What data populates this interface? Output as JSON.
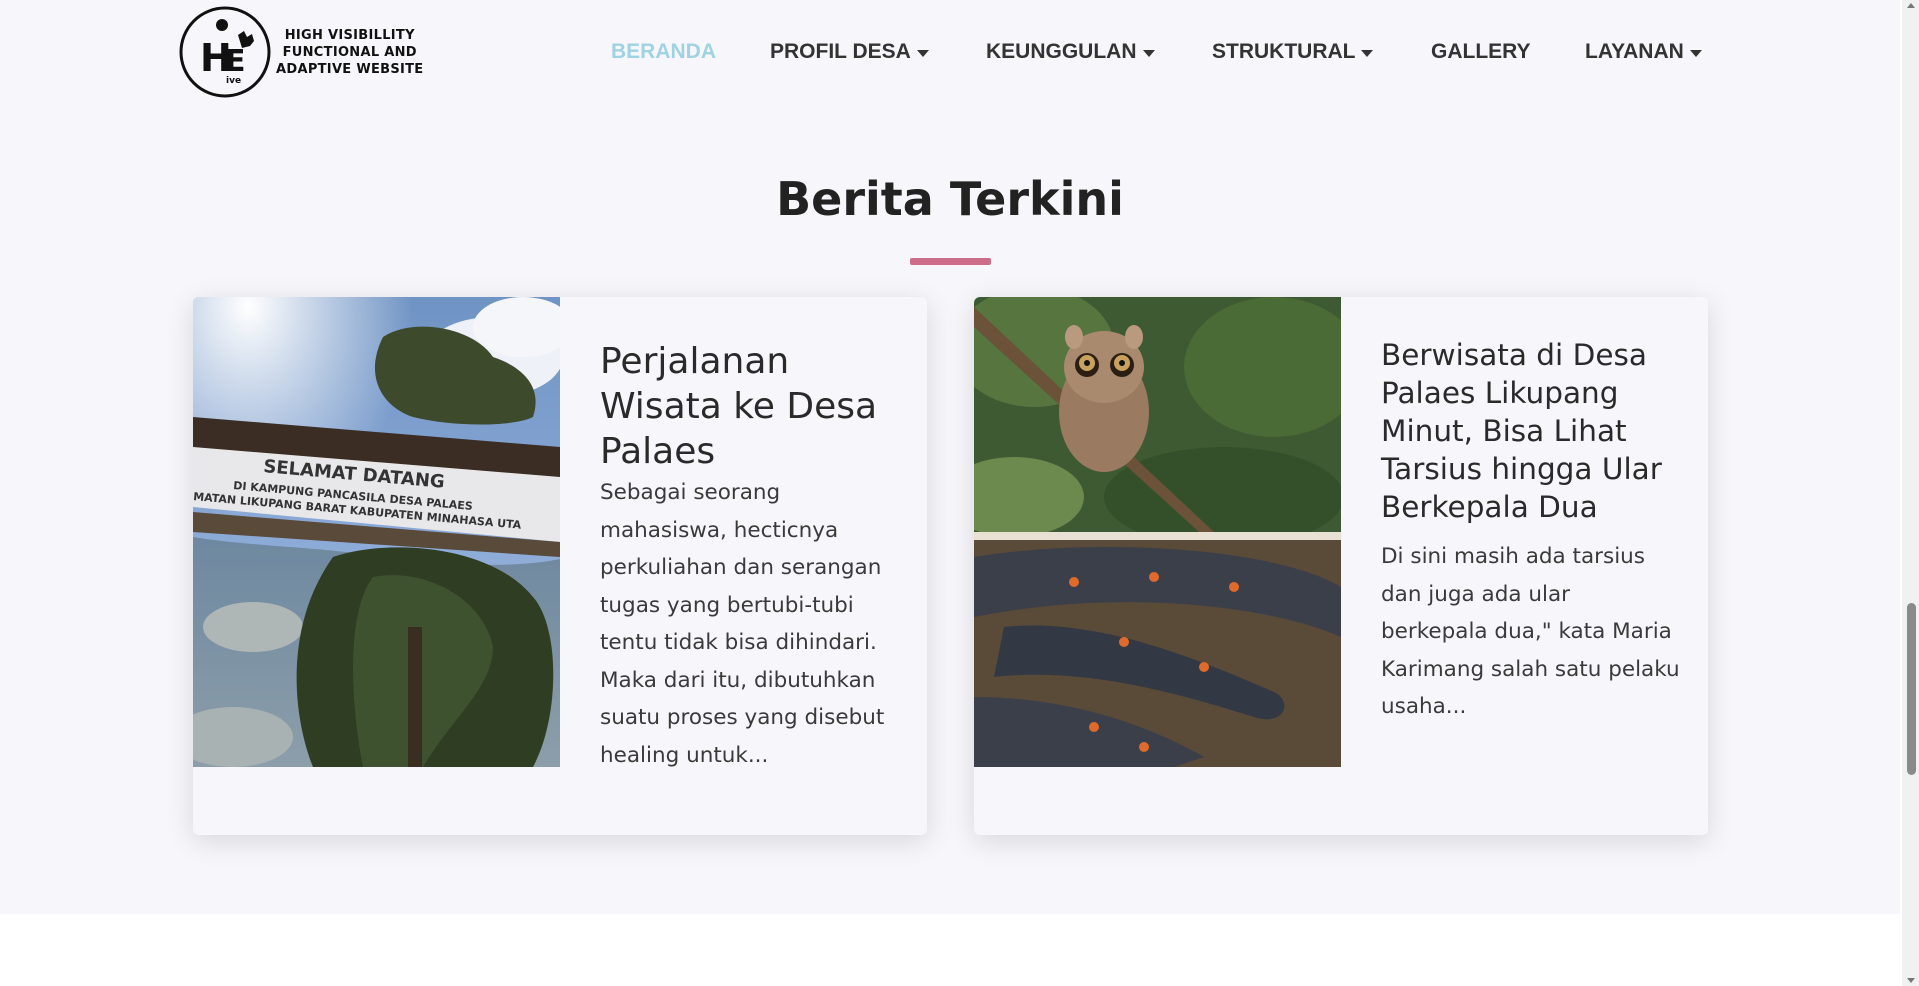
{
  "logo": {
    "line1": "HIGH VISIBILLITY",
    "line2": "FUNCTIONAL AND",
    "line3": "ADAPTIVE WEBSITE",
    "mark_letters": "HE",
    "mark_sub": "ive"
  },
  "nav": {
    "items": [
      {
        "label": "BERANDA",
        "active": true,
        "dropdown": false
      },
      {
        "label": "PROFIL DESA",
        "active": false,
        "dropdown": true
      },
      {
        "label": "KEUNGGULAN",
        "active": false,
        "dropdown": true
      },
      {
        "label": "STRUKTURAL",
        "active": false,
        "dropdown": true
      },
      {
        "label": "GALLERY",
        "active": false,
        "dropdown": false
      },
      {
        "label": "LAYANAN",
        "active": false,
        "dropdown": true
      }
    ]
  },
  "section": {
    "title": "Berita Terkini"
  },
  "articles": [
    {
      "title": "Perjalanan Wisata ke Desa Palaes",
      "excerpt": "Sebagai seorang mahasiswa, hecticnya perkuliahan dan serangan tugas yang bertubi-tubi tentu tidak bisa dihindari. Maka dari itu, dibutuhkan suatu proses yang disebut healing untuk...",
      "image_text_1": "SELAMAT DATANG",
      "image_text_2": "DI KAMPUNG PANCASILA DESA PALAES",
      "image_text_3": "MATAN LIKUPANG BARAT KABUPATEN MINAHASA UTA"
    },
    {
      "title": "Berwisata di Desa Palaes Likupang Minut, Bisa Lihat Tarsius hingga Ular Berkepala Dua",
      "excerpt": "Di sini masih ada tarsius dan juga ada ular berkepala dua,\" kata Maria Karimang salah satu pelaku usaha..."
    }
  ],
  "colors": {
    "active_nav": "#9fd3e4",
    "accent_bar": "#cc6c88",
    "page_bg": "#f7f7fb"
  }
}
